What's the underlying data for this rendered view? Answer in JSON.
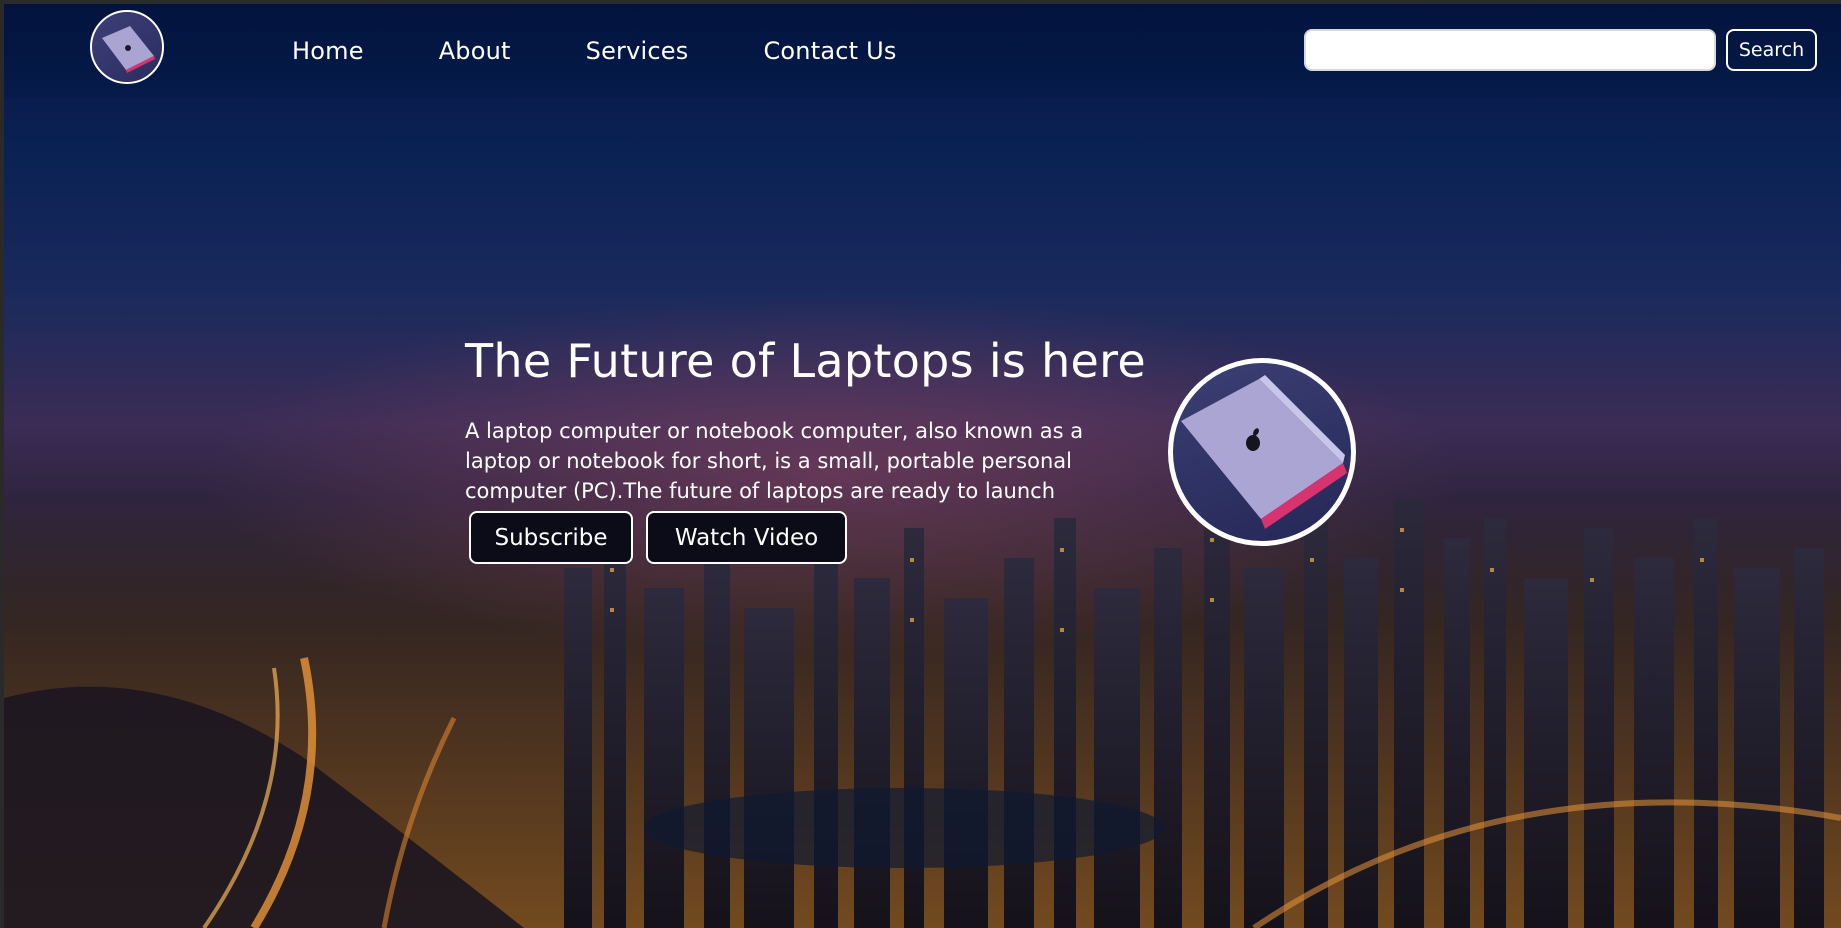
{
  "nav": {
    "items": [
      {
        "label": "Home"
      },
      {
        "label": "About"
      },
      {
        "label": "Services"
      },
      {
        "label": "Contact Us"
      }
    ]
  },
  "search": {
    "value": "",
    "placeholder": "",
    "button_label": "Search"
  },
  "hero": {
    "title": "The Future of Laptops is here",
    "description": "A laptop computer or notebook computer, also known as a laptop or notebook for short, is a small, portable personal computer (PC).The future of laptops are ready to launch",
    "subscribe_label": "Subscribe",
    "watch_label": "Watch Video"
  },
  "icons": {
    "logo": "laptop-logo-icon",
    "hero_image": "laptop-image"
  },
  "colors": {
    "header_bg": "#041a48",
    "text": "#ffffff",
    "button_bg": "#0c0c18",
    "laptop_body": "#b8b4dc",
    "laptop_edge": "#e23c7a"
  }
}
